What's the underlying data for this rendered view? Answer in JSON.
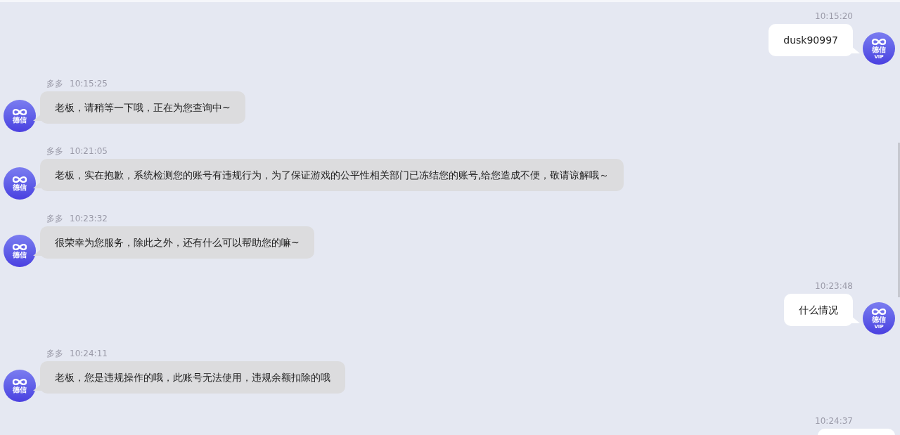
{
  "messages": [
    {
      "kind": "out",
      "time": "10:15:20",
      "text": "dusk90997",
      "avatar": {
        "logo_text": "德信",
        "badge": "VIP"
      }
    },
    {
      "kind": "in",
      "sender": "多多",
      "time": "10:15:25",
      "text": "老板，请稍等一下哦，正在为您查询中~",
      "avatar": {
        "logo_text": "德信"
      }
    },
    {
      "kind": "in",
      "sender": "多多",
      "time": "10:21:05",
      "text": "老板，实在抱歉，系统检测您的账号有违规行为，为了保证游戏的公平性相关部门已冻结您的账号,给您造成不便，敬请谅解哦～",
      "avatar": {
        "logo_text": "德信"
      }
    },
    {
      "kind": "in",
      "sender": "多多",
      "time": "10:23:32",
      "text": "很荣幸为您服务，除此之外，还有什么可以帮助您的嘛~",
      "avatar": {
        "logo_text": "德信"
      }
    },
    {
      "kind": "out",
      "time": "10:23:48",
      "text": "什么情况",
      "avatar": {
        "logo_text": "德信",
        "badge": "VIP"
      }
    },
    {
      "kind": "in",
      "sender": "多多",
      "time": "10:24:11",
      "text": "老板，您是违规操作的哦，此账号无法使用，违规余额扣除的哦",
      "avatar": {
        "logo_text": "德信"
      }
    },
    {
      "kind": "out",
      "time": "10:24:37"
    }
  ]
}
